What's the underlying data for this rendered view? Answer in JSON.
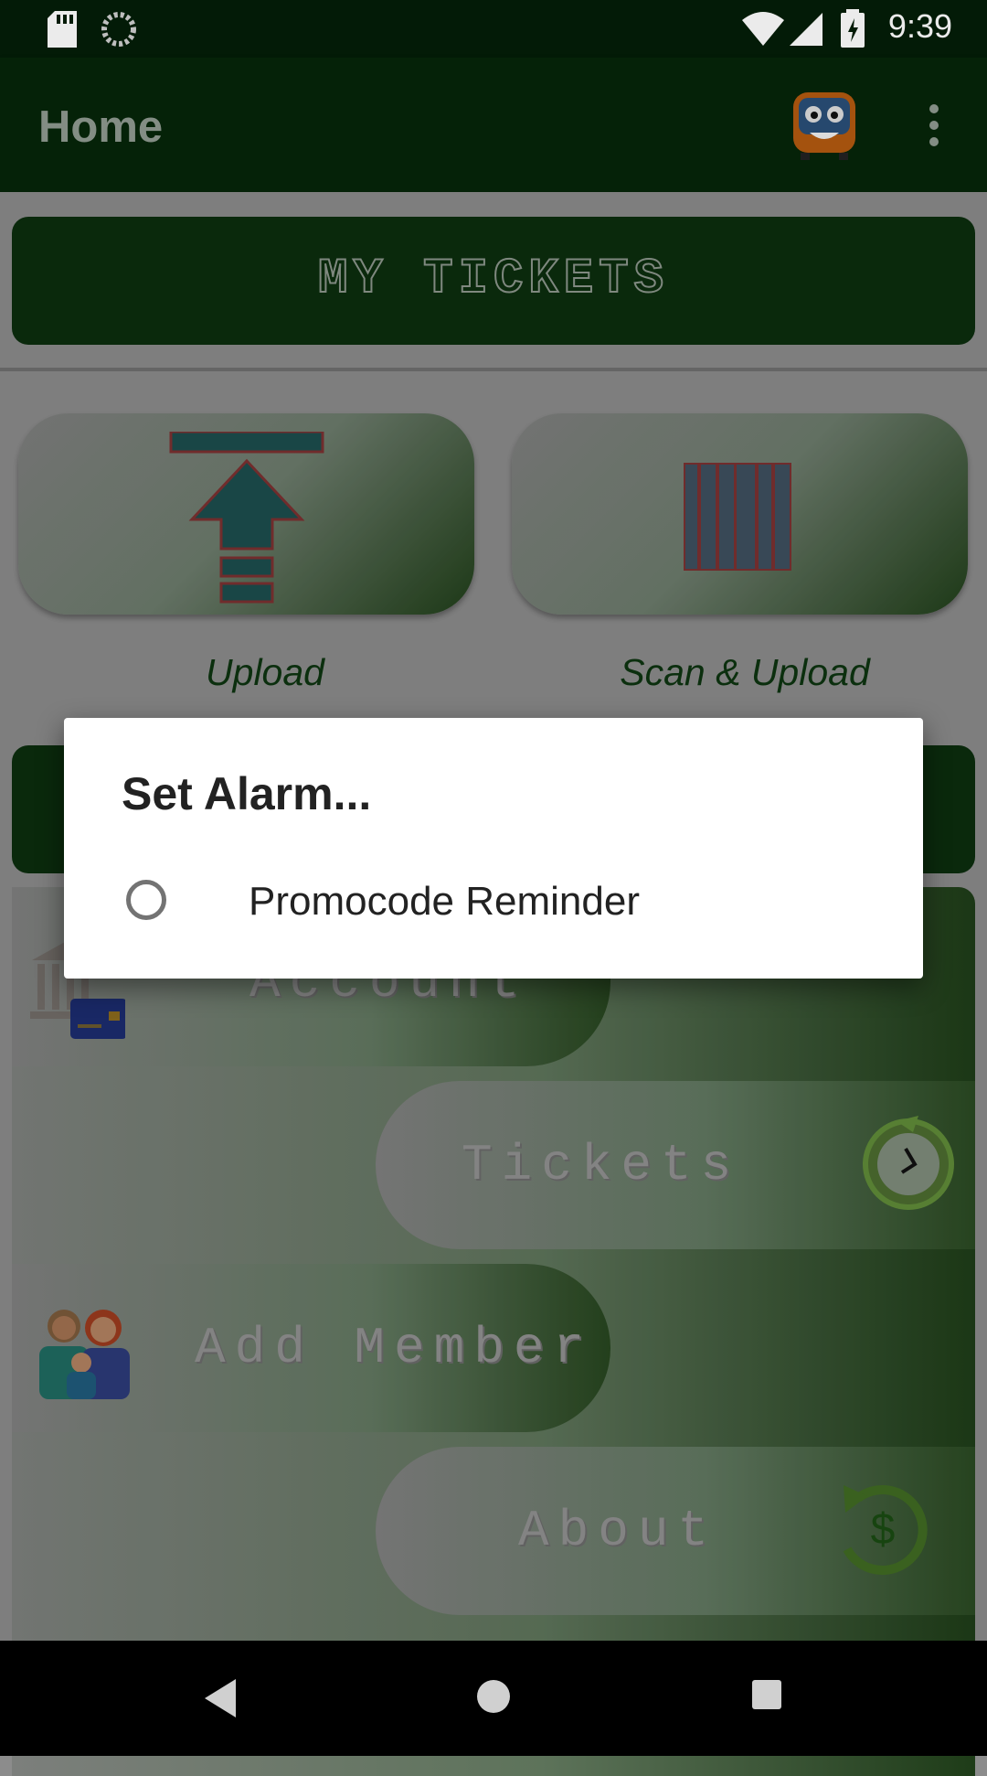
{
  "status_bar": {
    "time": "9:39",
    "icons": [
      "sd-card-icon",
      "sync-icon",
      "wifi-icon",
      "signal-icon",
      "battery-icon"
    ]
  },
  "app_bar": {
    "title": "Home",
    "icons": [
      "bus-mascot-icon",
      "overflow-menu-icon"
    ]
  },
  "main": {
    "my_tickets_label": "MY TICKETS",
    "tiles": [
      {
        "label": "Upload",
        "icon": "upload-arrow-icon"
      },
      {
        "label": "Scan & Upload",
        "icon": "barcode-icon"
      }
    ],
    "menu": [
      {
        "label": "Account",
        "icon": "bank-card-icon"
      },
      {
        "label": "Tickets",
        "icon": "clock-icon"
      },
      {
        "label": "Add Member",
        "icon": "family-icon"
      },
      {
        "label": "About",
        "icon": "dollar-refresh-icon"
      }
    ]
  },
  "dialog": {
    "title": "Set Alarm...",
    "options": [
      {
        "label": "Promocode Reminder",
        "selected": false
      }
    ]
  },
  "nav_bar": {
    "icons": [
      "back-icon",
      "home-icon",
      "recents-icon"
    ]
  }
}
